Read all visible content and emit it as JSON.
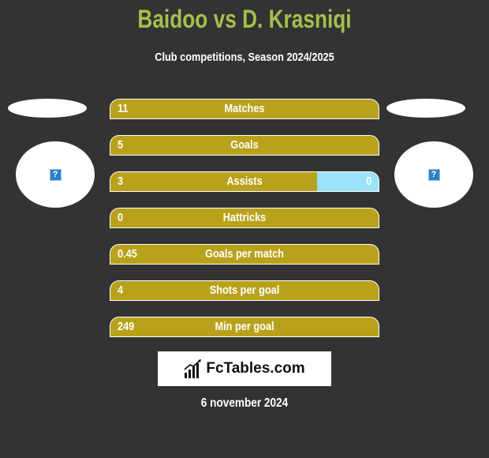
{
  "header": {
    "title": "Baidoo vs D. Krasniqi",
    "subtitle": "Club competitions, Season 2024/2025"
  },
  "players": {
    "left": {
      "name": "Baidoo",
      "photo_icon": "missing-image-icon",
      "icon_glyph": "?"
    },
    "right": {
      "name": "D. Krasniqi",
      "photo_icon": "missing-image-icon",
      "icon_glyph": "?"
    }
  },
  "colors": {
    "title": "#a5bf4b",
    "left_bar": "#b9a21b",
    "right_bar": "#99e4fb",
    "background": "#333333"
  },
  "stats": [
    {
      "label": "Matches",
      "left": "11",
      "right": "",
      "right_share": 0
    },
    {
      "label": "Goals",
      "left": "5",
      "right": "",
      "right_share": 0
    },
    {
      "label": "Assists",
      "left": "3",
      "right": "0",
      "right_share": 0.23
    },
    {
      "label": "Hattricks",
      "left": "0",
      "right": "",
      "right_share": 0
    },
    {
      "label": "Goals per match",
      "left": "0.45",
      "right": "",
      "right_share": 0
    },
    {
      "label": "Shots per goal",
      "left": "4",
      "right": "",
      "right_share": 0
    },
    {
      "label": "Min per goal",
      "left": "249",
      "right": "",
      "right_share": 0
    }
  ],
  "footer": {
    "logo_text": "FcTables.com",
    "logo_icon": "bar-chart-icon",
    "date": "6 november 2024"
  }
}
